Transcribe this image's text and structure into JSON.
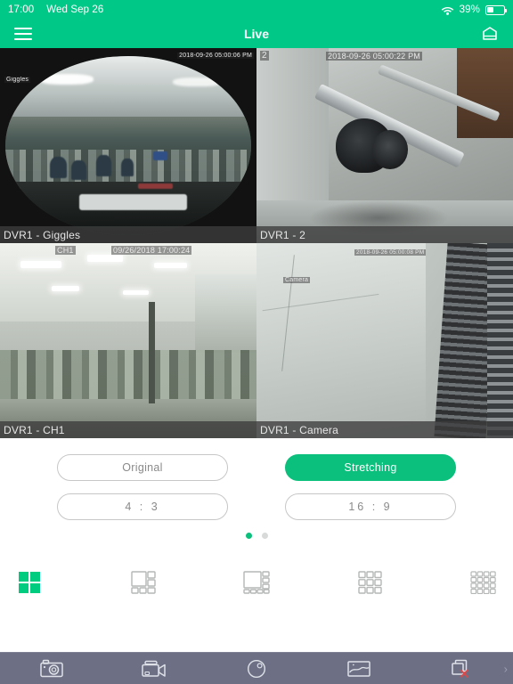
{
  "status_bar": {
    "time": "17:00",
    "date": "Wed Sep 26",
    "battery_percent": "39%",
    "battery_level": 39,
    "wifi_icon": "wifi-icon",
    "battery_icon": "battery-icon"
  },
  "nav_bar": {
    "menu_icon": "hamburger-menu-icon",
    "title": "Live",
    "device_icon": "dvr-device-icon"
  },
  "cameras": [
    {
      "label": "DVR1 - Giggles",
      "osd_name": "Giggles",
      "osd_time": "2018-09-26 05:00:06 PM",
      "selected": true,
      "scene": "fisheye-office"
    },
    {
      "label": "DVR1 - 2",
      "osd_name": "2",
      "osd_time": "2018-09-26 05:00:22 PM",
      "selected": false,
      "scene": "pipes-corridor"
    },
    {
      "label": "DVR1 - CH1",
      "osd_name": "CH1",
      "osd_time": "09/26/2018 17:00:24",
      "selected": false,
      "scene": "bright-office"
    },
    {
      "label": "DVR1 - Camera",
      "osd_name": "Camera",
      "osd_time": "2018-09-26 05:00:08 PM",
      "selected": false,
      "scene": "cable-rack"
    }
  ],
  "aspect_buttons": [
    {
      "label": "Original",
      "active": false
    },
    {
      "label": "Stretching",
      "active": true
    },
    {
      "label": "4  :  3",
      "active": false
    },
    {
      "label": "16  :  9",
      "active": false
    }
  ],
  "pager": {
    "pages": 2,
    "active_index": 0
  },
  "layouts": [
    {
      "name": "layout-4-grid-icon",
      "panes": 4,
      "active": true
    },
    {
      "name": "layout-6-icon",
      "panes": 6,
      "active": false
    },
    {
      "name": "layout-8-icon",
      "panes": 8,
      "active": false
    },
    {
      "name": "layout-9-grid-icon",
      "panes": 9,
      "active": false
    },
    {
      "name": "layout-16-grid-icon",
      "panes": 16,
      "active": false
    }
  ],
  "toolbar": [
    {
      "name": "snapshot-camera-icon"
    },
    {
      "name": "record-video-icon"
    },
    {
      "name": "audio-mute-icon"
    },
    {
      "name": "image-playback-icon"
    },
    {
      "name": "close-all-streams-icon"
    }
  ],
  "toolbar_chevron": "›",
  "colors": {
    "accent_green": "#00c987",
    "button_green": "#0bc07c",
    "toolbar_gray": "#6d7084",
    "label_gray": "#3c3c3c",
    "selected_outline": "#d8d15a",
    "close_red": "#d94b4b"
  }
}
